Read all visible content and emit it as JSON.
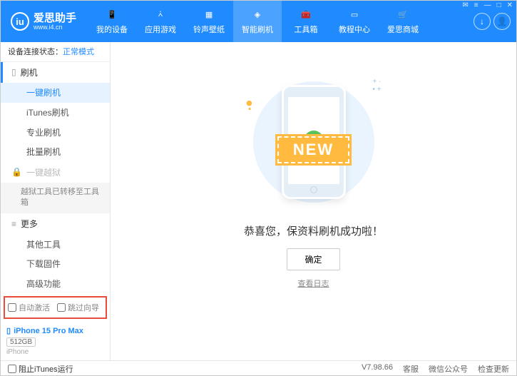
{
  "header": {
    "logo_text": "爱思助手",
    "logo_url": "www.i4.cn",
    "logo_badge": "iu",
    "nav": [
      {
        "label": "我的设备"
      },
      {
        "label": "应用游戏"
      },
      {
        "label": "铃声壁纸"
      },
      {
        "label": "智能刷机"
      },
      {
        "label": "工具箱"
      },
      {
        "label": "教程中心"
      },
      {
        "label": "爱思商城"
      }
    ]
  },
  "sidebar": {
    "status_label": "设备连接状态：",
    "status_value": "正常模式",
    "section_flash": "刷机",
    "items_flash": [
      {
        "label": "一键刷机"
      },
      {
        "label": "iTunes刷机"
      },
      {
        "label": "专业刷机"
      },
      {
        "label": "批量刷机"
      }
    ],
    "section_jailbreak": "一键越狱",
    "jailbreak_note": "越狱工具已转移至工具箱",
    "section_more": "更多",
    "items_more": [
      {
        "label": "其他工具"
      },
      {
        "label": "下载固件"
      },
      {
        "label": "高级功能"
      }
    ],
    "cb_auto_activate": "自动激活",
    "cb_skip_wizard": "跳过向导",
    "device_name": "iPhone 15 Pro Max",
    "device_storage": "512GB",
    "device_type": "iPhone"
  },
  "main": {
    "ribbon": "NEW",
    "success": "恭喜您，保资料刷机成功啦！",
    "ok": "确定",
    "view_log": "查看日志"
  },
  "footer": {
    "block_itunes": "阻止iTunes运行",
    "version": "V7.98.66",
    "links": [
      "客服",
      "微信公众号",
      "检查更新"
    ]
  }
}
